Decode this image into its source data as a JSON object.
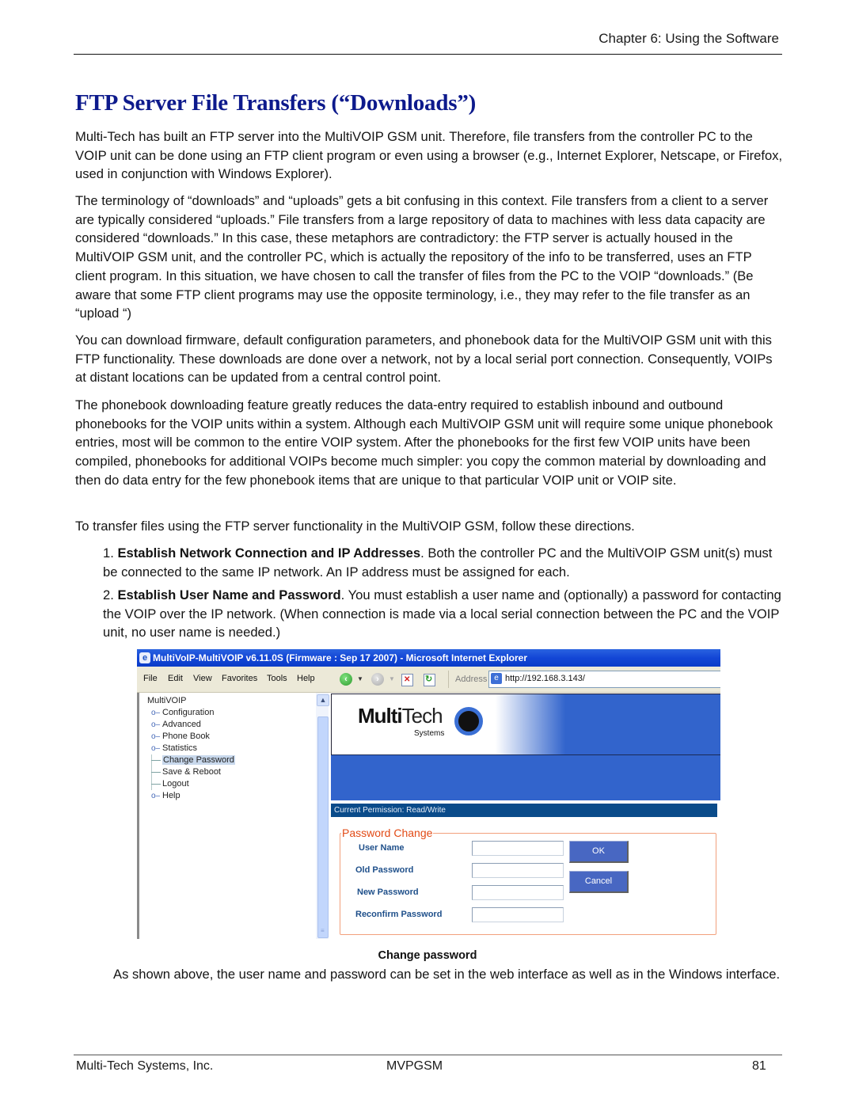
{
  "header": {
    "chapter": "Chapter 6: Using the Software"
  },
  "title": "FTP Server File Transfers (“Downloads”)",
  "paragraphs": [
    "Multi-Tech has built an FTP server into the MultiVOIP GSM unit.  Therefore, file transfers from the controller PC to the VOIP unit can be done using an FTP client program or even using a browser (e.g., Internet Explorer, Netscape, or Firefox, used in conjunction with Windows Explorer).",
    "The terminology of “downloads” and “uploads” gets a bit confusing in this context. File transfers from a client to a server are typically considered “uploads.”  File transfers from a large repository of data to machines with less data capacity are considered “downloads.”  In this case, these metaphors are contradictory: the FTP server is actually housed in the  MultiVOIP GSM unit, and the controller PC, which is actually the repository of the info to be transferred, uses an FTP client program.  In this situation, we have chosen to call the transfer of files from the PC to the VOIP “downloads.”  (Be aware that some FTP client programs may use the opposite terminology, i.e., they may refer to the file transfer as an “upload “)",
    "You can download firmware, default configuration parameters, and phonebook data for the MultiVOIP GSM unit with this FTP functionality.  These downloads are done over a network, not by a local serial port connection. Consequently, VOIPs at distant locations can be updated from a central control point.",
    "The phonebook downloading feature greatly reduces the data-entry required to establish inbound and outbound phonebooks for the VOIP units within a system. Although each MultiVOIP GSM unit will require some unique phonebook entries, most will be common to the entire VOIP system.  After the phonebooks for the first few VOIP units have been compiled, phonebooks for additional VOIPs become much simpler: you copy the common material by downloading and then do data entry for the few phonebook items that are unique to that particular VOIP unit or VOIP site.",
    "To transfer files using the FTP server functionality in the MultiVOIP GSM, follow these directions."
  ],
  "steps": [
    {
      "num": "1.",
      "lead": "Establish Network Connection and IP Addresses",
      "text": ".  Both the controller PC and the MultiVOIP GSM unit(s) must be connected to the same IP network.  An IP address must be assigned for each."
    },
    {
      "num": "2.",
      "lead": "Establish User Name and Password",
      "text": ".  You must establish a user name and (optionally) a password for contacting the VOIP over the IP network.  (When connection is made via a local serial connection between the PC and the VOIP unit, no user name is needed.)"
    }
  ],
  "screenshot": {
    "window_title": "MultiVoIP-MultiVOIP v6.11.0S (Firmware : Sep 17 2007) - Microsoft Internet Explorer",
    "menu": [
      "File",
      "Edit",
      "View",
      "Favorites",
      "Tools",
      "Help"
    ],
    "address_label": "Address",
    "url": "http://192.168.3.143/",
    "icons": {
      "back": "back-arrow-icon",
      "forward": "forward-arrow-icon",
      "stop": "stop-icon",
      "refresh": "refresh-icon"
    },
    "tree": {
      "root": "MultiVOIP",
      "items": [
        {
          "label": "Configuration",
          "type": "folder"
        },
        {
          "label": "Advanced",
          "type": "folder"
        },
        {
          "label": "Phone Book",
          "type": "folder"
        },
        {
          "label": "Statistics",
          "type": "folder"
        },
        {
          "label": "Change Password",
          "type": "leaf",
          "selected": true
        },
        {
          "label": "Save & Reboot",
          "type": "leaf"
        },
        {
          "label": "Logout",
          "type": "leaf"
        },
        {
          "label": "Help",
          "type": "folder"
        }
      ]
    },
    "logo": {
      "bold": "Multi",
      "light": "Tech",
      "sub": "Systems"
    },
    "permission": "Current Permission:  Read/Write",
    "form": {
      "legend": "Password Change",
      "fields": [
        {
          "label": "User Name",
          "value": ""
        },
        {
          "label": "Old Password",
          "value": ""
        },
        {
          "label": "New Password",
          "value": ""
        },
        {
          "label": "Reconfirm Password",
          "value": ""
        }
      ],
      "ok_label": "OK",
      "cancel_label": "Cancel"
    },
    "colors": {
      "title_bar": "#1346d6",
      "banner_blue": "#3264cc",
      "permission_bar": "#0a4b8a",
      "legend": "#e24a15",
      "field_label": "#1e4f8a",
      "button": "#4867c2"
    }
  },
  "caption": "Change password",
  "after_text": "As shown above, the user name and password can be set in the web interface as well as in the Windows interface.",
  "footer": {
    "company": "Multi-Tech Systems, Inc.",
    "product": "MVPGSM",
    "page": "81"
  },
  "colors": {
    "title": "#0d1a8c"
  }
}
